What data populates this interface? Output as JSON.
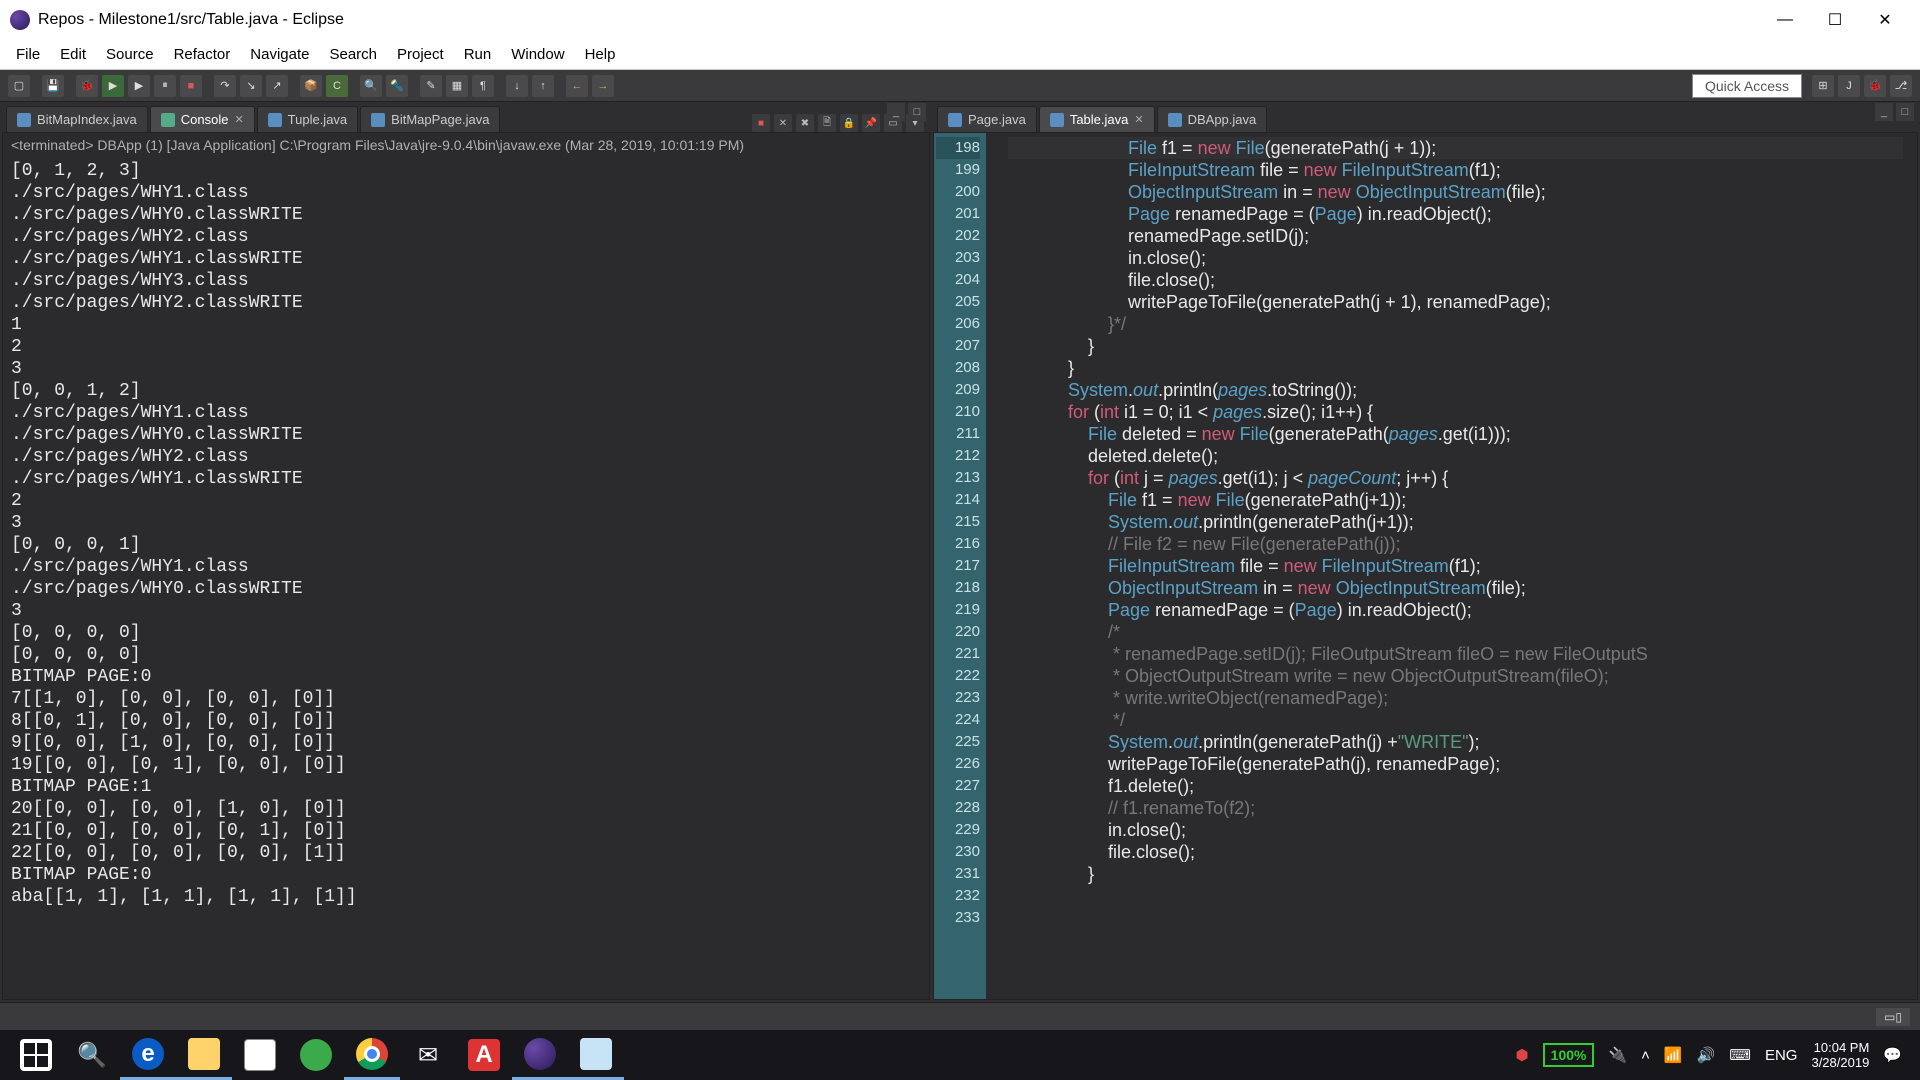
{
  "title": "Repos - Milestone1/src/Table.java - Eclipse",
  "menus": [
    "File",
    "Edit",
    "Source",
    "Refactor",
    "Navigate",
    "Search",
    "Project",
    "Run",
    "Window",
    "Help"
  ],
  "quick_access": "Quick Access",
  "left_tabs": [
    {
      "label": "BitMapIndex.java",
      "active": false
    },
    {
      "label": "Console",
      "active": true,
      "closable": true
    },
    {
      "label": "Tuple.java",
      "active": false
    },
    {
      "label": "BitMapPage.java",
      "active": false
    }
  ],
  "right_tabs": [
    {
      "label": "Page.java",
      "active": false
    },
    {
      "label": "Table.java",
      "active": true,
      "closable": true
    },
    {
      "label": "DBApp.java",
      "active": false
    }
  ],
  "console_header": "<terminated> DBApp (1) [Java Application] C:\\Program Files\\Java\\jre-9.0.4\\bin\\javaw.exe (Mar 28, 2019, 10:01:19 PM)",
  "console_lines": [
    "[0, 1, 2, 3]",
    "./src/pages/WHY1.class",
    "./src/pages/WHY0.classWRITE",
    "./src/pages/WHY2.class",
    "./src/pages/WHY1.classWRITE",
    "./src/pages/WHY3.class",
    "./src/pages/WHY2.classWRITE",
    "1",
    "2",
    "3",
    "[0, 0, 1, 2]",
    "./src/pages/WHY1.class",
    "./src/pages/WHY0.classWRITE",
    "./src/pages/WHY2.class",
    "./src/pages/WHY1.classWRITE",
    "2",
    "3",
    "[0, 0, 0, 1]",
    "./src/pages/WHY1.class",
    "./src/pages/WHY0.classWRITE",
    "3",
    "[0, 0, 0, 0]",
    "[0, 0, 0, 0]",
    "BITMAP PAGE:0",
    "7[[1, 0], [0, 0], [0, 0], [0]]",
    "8[[0, 1], [0, 0], [0, 0], [0]]",
    "9[[0, 0], [1, 0], [0, 0], [0]]",
    "19[[0, 0], [0, 1], [0, 0], [0]]",
    "BITMAP PAGE:1",
    "20[[0, 0], [0, 0], [1, 0], [0]]",
    "21[[0, 0], [0, 0], [0, 1], [0]]",
    "22[[0, 0], [0, 0], [0, 0], [1]]",
    "BITMAP PAGE:0",
    "aba[[1, 1], [1, 1], [1, 1], [1]]"
  ],
  "code_start_line": 198,
  "code_lines": [
    {
      "n": 198,
      "t": "                        File f1 = new File(generatePath(j + 1));",
      "raw": false,
      "kw": [
        "new"
      ],
      "ty": [
        "File"
      ]
    },
    {
      "n": 199,
      "t": "                        FileInputStream file = new FileInputStream(f1);"
    },
    {
      "n": 200,
      "t": "                        ObjectInputStream in = new ObjectInputStream(file);"
    },
    {
      "n": 201,
      "t": "                        Page renamedPage = (Page) in.readObject();"
    },
    {
      "n": 202,
      "t": "                        renamedPage.setID(j);"
    },
    {
      "n": 203,
      "t": "                        in.close();"
    },
    {
      "n": 204,
      "t": "                        file.close();"
    },
    {
      "n": 205,
      "t": "                        writePageToFile(generatePath(j + 1), renamedPage);"
    },
    {
      "n": 206,
      "t": "                    }*/",
      "cmt": true
    },
    {
      "n": 207,
      "t": "                }"
    },
    {
      "n": 208,
      "t": "            }"
    },
    {
      "n": 209,
      "t": "            System.out.println(pages.toString());"
    },
    {
      "n": 210,
      "t": ""
    },
    {
      "n": 211,
      "t": "            for (int i1 = 0; i1 < pages.size(); i1++) {"
    },
    {
      "n": 212,
      "t": "                File deleted = new File(generatePath(pages.get(i1)));"
    },
    {
      "n": 213,
      "t": "                deleted.delete();"
    },
    {
      "n": 214,
      "t": "                for (int j = pages.get(i1); j < pageCount; j++) {"
    },
    {
      "n": 215,
      "t": "                    File f1 = new File(generatePath(j+1));"
    },
    {
      "n": 216,
      "t": "                    System.out.println(generatePath(j+1));"
    },
    {
      "n": 217,
      "t": "                    // File f2 = new File(generatePath(j));",
      "cmt": true
    },
    {
      "n": 218,
      "t": "                    FileInputStream file = new FileInputStream(f1);"
    },
    {
      "n": 219,
      "t": "                    ObjectInputStream in = new ObjectInputStream(file);"
    },
    {
      "n": 220,
      "t": "                    Page renamedPage = (Page) in.readObject();"
    },
    {
      "n": 221,
      "t": "                    /*",
      "cmt": true
    },
    {
      "n": 222,
      "t": "                     * renamedPage.setID(j); FileOutputStream fileO = new FileOutputS",
      "cmt": true
    },
    {
      "n": 223,
      "t": "                     * ObjectOutputStream write = new ObjectOutputStream(fileO);",
      "cmt": true
    },
    {
      "n": 224,
      "t": "                     * write.writeObject(renamedPage);",
      "cmt": true
    },
    {
      "n": 225,
      "t": "                     */",
      "cmt": true
    },
    {
      "n": 226,
      "t": "                    System.out.println(generatePath(j) +\"WRITE\");"
    },
    {
      "n": 227,
      "t": "                    writePageToFile(generatePath(j), renamedPage);"
    },
    {
      "n": 228,
      "t": "                    f1.delete();"
    },
    {
      "n": 229,
      "t": "                    // f1.renameTo(f2);",
      "cmt": true
    },
    {
      "n": 230,
      "t": "                    in.close();"
    },
    {
      "n": 231,
      "t": "                    file.close();"
    },
    {
      "n": 232,
      "t": ""
    },
    {
      "n": 233,
      "t": "                }"
    }
  ],
  "tray": {
    "battery": "100%",
    "lang": "ENG",
    "time": "10:04 PM",
    "date": "3/28/2019"
  }
}
